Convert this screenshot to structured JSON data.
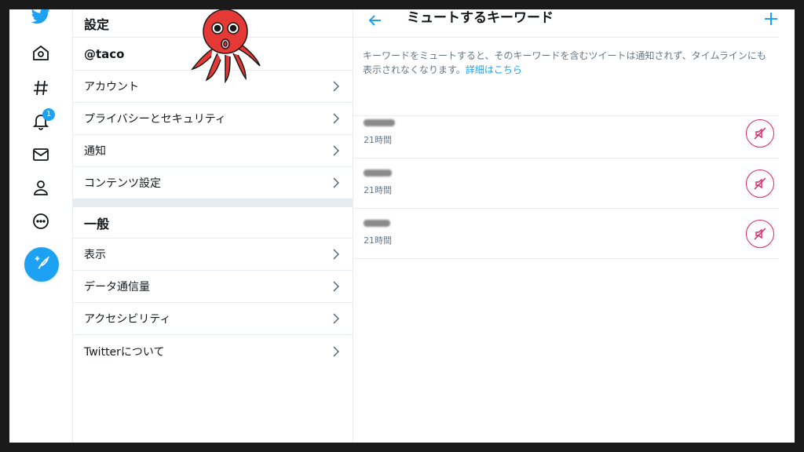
{
  "nav": {
    "notification_count": "1"
  },
  "settings": {
    "title": "設定",
    "username": "@taco",
    "account_items": [
      {
        "label": "アカウント"
      },
      {
        "label": "プライバシーとセキュリティ"
      },
      {
        "label": "通知"
      },
      {
        "label": "コンテンツ設定"
      }
    ],
    "general_title": "一般",
    "general_items": [
      {
        "label": "表示"
      },
      {
        "label": "データ通信量"
      },
      {
        "label": "アクセシビリティ"
      },
      {
        "label": "Twitterについて"
      }
    ]
  },
  "muted": {
    "title": "ミュートするキーワード",
    "description": "キーワードをミュートすると、そのキーワードを含むツイートは通知されず、タイムラインにも表示されなくなります。",
    "learn_more": "詳細はこちら",
    "items": [
      {
        "time": "21時間"
      },
      {
        "time": "21時間"
      },
      {
        "time": "21時間"
      }
    ]
  },
  "colors": {
    "accent": "#1da1f2",
    "unmute": "#e0245e",
    "divider": "#e6ecf0"
  },
  "icons": {
    "logo": "twitter-bird-icon",
    "home": "home-icon",
    "explore": "hashtag-icon",
    "notifications": "bell-icon",
    "messages": "envelope-icon",
    "profile": "person-icon",
    "more": "more-circle-icon",
    "compose": "compose-tweet-icon",
    "back": "back-arrow-icon",
    "add": "plus-icon",
    "unmute": "speaker-off-icon",
    "chevron": "chevron-right-icon"
  }
}
